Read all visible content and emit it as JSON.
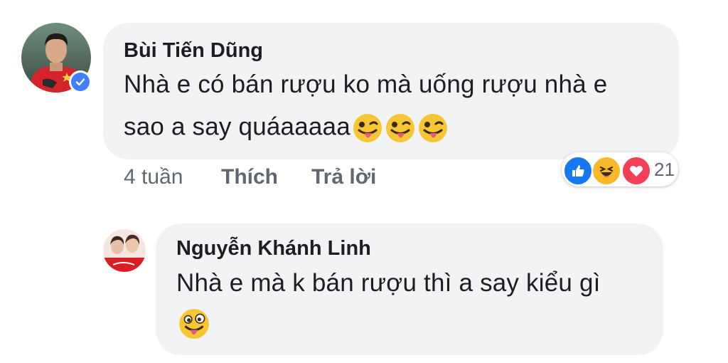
{
  "comment": {
    "author": "Bùi Tiến Dũng",
    "text_line1": "Nhà e có bán rượu ko mà uống rượu nhà e",
    "text_line2": "sao a say quáaaaaa",
    "time": "4 tuần",
    "like_label": "Thích",
    "reply_label": "Trả lời",
    "reaction_count": "21",
    "reactions": [
      "like-icon",
      "haha-icon",
      "love-icon"
    ]
  },
  "reply": {
    "author": "Nguyễn Khánh Linh",
    "text_line1": "Nhà e mà k bán rượu thì a say kiểu gì"
  },
  "colors": {
    "bubble": "#f2f3f5",
    "verified": "#4080ff",
    "like": "#1877f2",
    "love": "#f33e58",
    "haha": "#f7b928"
  }
}
